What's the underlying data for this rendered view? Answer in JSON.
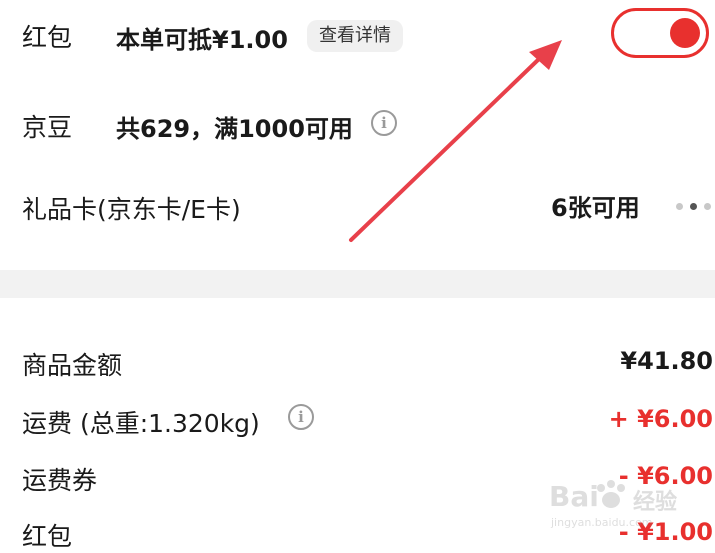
{
  "payment": {
    "hongbao": {
      "label": "红包",
      "desc": "本单可抵¥1.00",
      "detail_button": "查看详情",
      "toggle_on": true
    },
    "jingdou": {
      "label": "京豆",
      "desc": "共629，满1000可用",
      "info_icon": "i"
    },
    "giftcard": {
      "label": "礼品卡(京东卡/E卡)",
      "available": "6张可用"
    }
  },
  "summary": {
    "goods": {
      "label": "商品金额",
      "value": "¥41.80"
    },
    "freight": {
      "label": "运费 (总重:1.320kg)",
      "value": "+ ¥6.00",
      "info_icon": "i"
    },
    "freight_coupon": {
      "label": "运费券",
      "value": "- ¥6.00"
    },
    "hongbao": {
      "label": "红包",
      "value": "- ¥1.00"
    }
  },
  "watermark": {
    "brand": "Bai",
    "brand_cn": "经验",
    "site": "jingyan.baidu.com"
  },
  "colors": {
    "accent": "#e8302e",
    "annotation_arrow": "#e8404a",
    "text": "#1a1a1a",
    "muted": "#9a9a9a",
    "gap": "#f2f2f2"
  }
}
